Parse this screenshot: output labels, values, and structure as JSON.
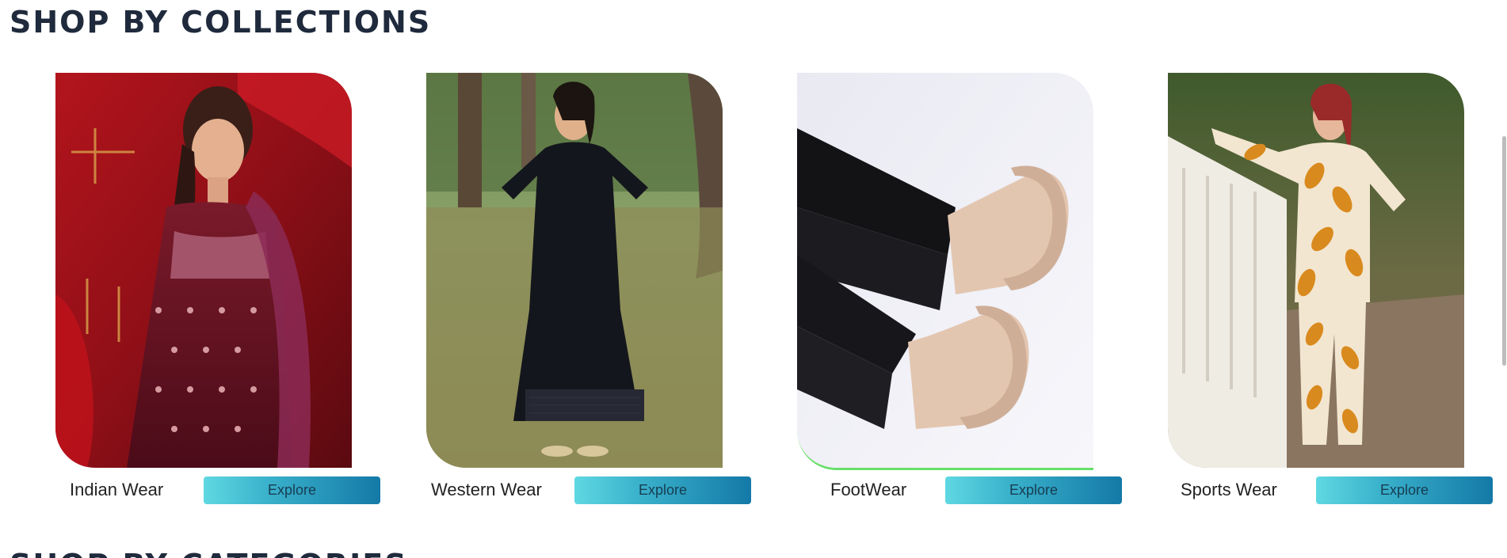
{
  "section": {
    "title": "SHOP BY COLLECTIONS",
    "next_title": "SHOP BY CATEGORIES"
  },
  "collections": [
    {
      "label": "Indian Wear",
      "button": "Explore"
    },
    {
      "label": "Western Wear",
      "button": "Explore"
    },
    {
      "label": "FootWear",
      "button": "Explore"
    },
    {
      "label": "Sports Wear",
      "button": "Explore"
    }
  ],
  "colors": {
    "title": "#1f2a3c",
    "button_gradient_start": "#5fd8e2",
    "button_gradient_end": "#1479a7"
  }
}
